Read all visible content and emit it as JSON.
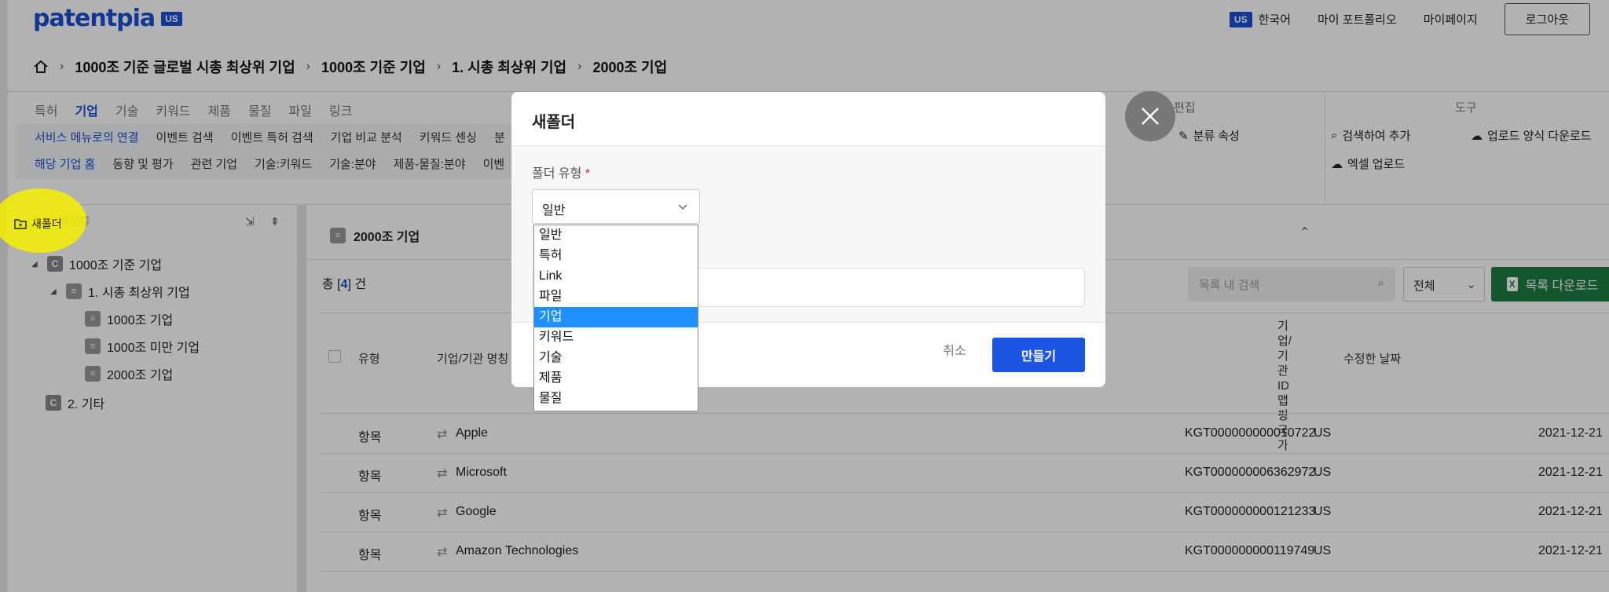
{
  "header": {
    "logo": "patentpia",
    "logo_badge": "US",
    "lang_badge": "US",
    "lang_label": "한국어",
    "portfolio": "마이 포트폴리오",
    "mypage": "마이페이지",
    "logout": "로그아웃"
  },
  "breadcrumb": [
    "1000조 기준 글로벌 시총 최상위 기업",
    "1000조 기준 기업",
    "1. 시총 최상위 기업",
    "2000조 기업"
  ],
  "tabs": [
    "특허",
    "기업",
    "기술",
    "키워드",
    "제품",
    "물질",
    "파일",
    "링크"
  ],
  "subrow1": [
    "서비스 메뉴로의 연결",
    "이벤트 검색",
    "이벤트 특허 검색",
    "기업 비교 분석",
    "키워드 센싱",
    "분"
  ],
  "subrow2": [
    "해당 기업 홈",
    "동향 및 평가",
    "관련 기업",
    "기술:키워드",
    "기술:분야",
    "제품-물질:분야",
    "이벤"
  ],
  "edit": {
    "partial": "편집",
    "classify": "분류 속성"
  },
  "tools": {
    "title": "도구",
    "search_add": "검색하여 추가",
    "upload_form": "업로드 양식 다운로드",
    "excel_upload": "엑셀 업로드"
  },
  "sidebar": {
    "new_folder": "새폴더",
    "new_class": "새분류",
    "tree": [
      {
        "badge": "C",
        "label": "1000조 기준 기업"
      },
      {
        "badge": "≡",
        "label": "1. 시총 최상위 기업"
      },
      {
        "badge": "≡",
        "label": "1000조 기업"
      },
      {
        "badge": "≡",
        "label": "1000조 미만 기업"
      },
      {
        "badge": "≡",
        "label": "2000조 기업"
      },
      {
        "badge": "C",
        "label": "2. 기타"
      }
    ]
  },
  "main": {
    "title": "2000조 기업",
    "count_prefix": "총 [",
    "count": "4",
    "count_suffix": "] 건",
    "search_placeholder": "목록 내 검색",
    "filter": "전체",
    "download": "목록 다운로드",
    "xl_icon": "X",
    "columns": {
      "type": "유형",
      "name": "기업/기관 명칭",
      "id_nation": "기업/기관ID맵핑국가",
      "date": "수정한 날짜"
    },
    "rows": [
      {
        "type": "항목",
        "name": "Apple",
        "id": "KGT000000000010722",
        "nation": "US",
        "date": "2021-12-21"
      },
      {
        "type": "항목",
        "name": "Microsoft",
        "id": "KGT000000006362972",
        "nation": "US",
        "date": "2021-12-21"
      },
      {
        "type": "항목",
        "name": "Google",
        "id": "KGT000000000121233",
        "nation": "US",
        "date": "2021-12-21"
      },
      {
        "type": "항목",
        "name": "Amazon Technologies",
        "id": "KGT000000000119749",
        "nation": "US",
        "date": "2021-12-21"
      }
    ]
  },
  "modal": {
    "title": "새폴더",
    "field_label": "폴더 유형",
    "required_mark": "*",
    "selected": "일반",
    "options": [
      "일반",
      "특허",
      "Link",
      "파일",
      "기업",
      "키워드",
      "기술",
      "제품",
      "물질"
    ],
    "highlighted_option": "기업",
    "cancel": "취소",
    "create": "만들기"
  },
  "colors": {
    "brand": "#1a4fd6",
    "excel_green": "#1e7c43",
    "option_highlight": "#1e90ff",
    "annotation_yellow": "#f5f000"
  }
}
